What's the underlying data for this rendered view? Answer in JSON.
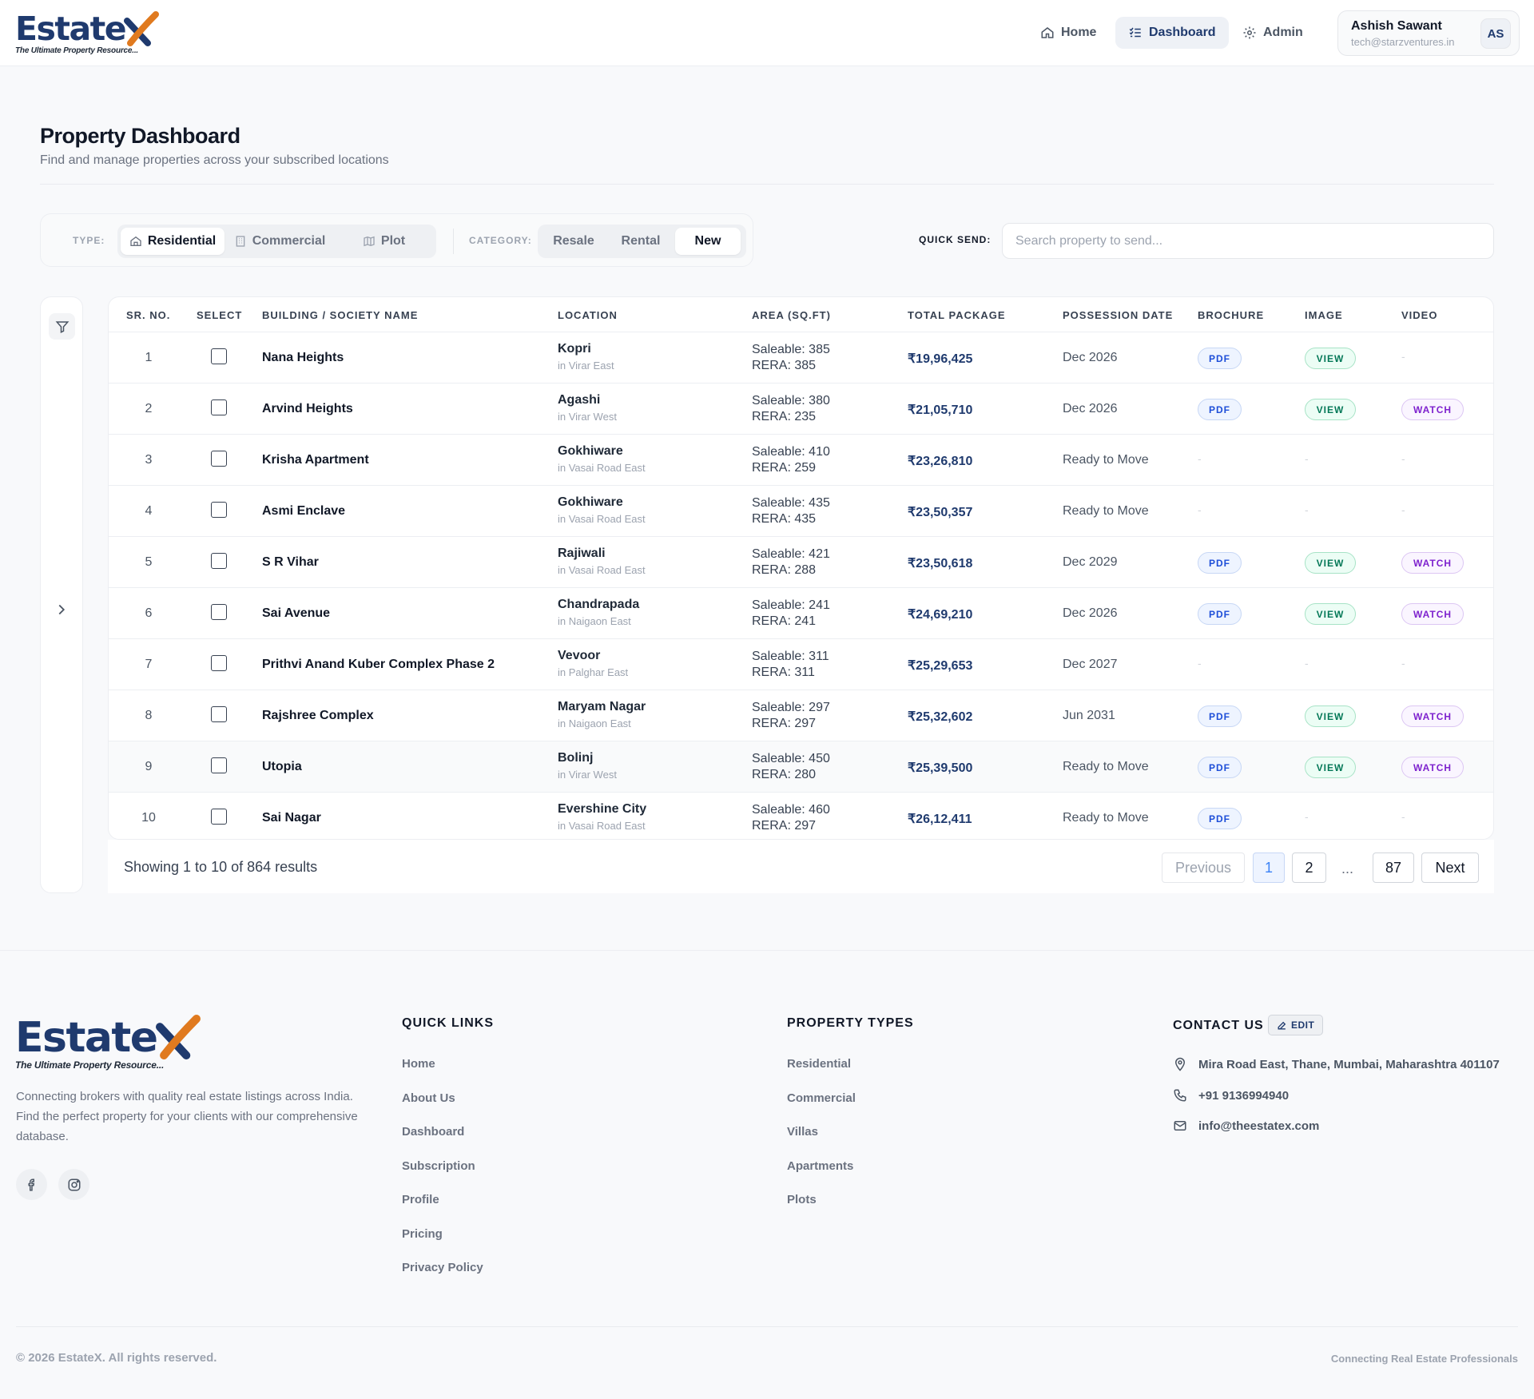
{
  "brand": {
    "name": "Estate",
    "tagline": "The Ultimate Property Resource..."
  },
  "nav": {
    "home": "Home",
    "dashboard": "Dashboard",
    "admin": "Admin"
  },
  "user": {
    "name": "Ashish Sawant",
    "email": "tech@starzventures.in",
    "initials": "AS"
  },
  "page": {
    "title": "Property Dashboard",
    "subtitle": "Find and manage properties across your subscribed locations"
  },
  "filters": {
    "type_label": "TYPE:",
    "types": [
      "Residential",
      "Commercial",
      "Plot"
    ],
    "active_type": "Residential",
    "category_label": "CATEGORY:",
    "categories": [
      "Resale",
      "Rental",
      "New"
    ],
    "active_category": "New"
  },
  "quick_send": {
    "label": "QUICK SEND:",
    "placeholder": "Search property to send..."
  },
  "table": {
    "headers": [
      "SR. NO.",
      "SELECT",
      "BUILDING / SOCIETY NAME",
      "LOCATION",
      "AREA (SQ.FT)",
      "TOTAL PACKAGE",
      "POSSESSION DATE",
      "BROCHURE",
      "IMAGE",
      "VIDEO"
    ],
    "labels": {
      "pdf": "PDF",
      "view": "VIEW",
      "watch": "WATCH",
      "none": "-"
    },
    "rows": [
      {
        "sr": "1",
        "name": "Nana Heights",
        "loc": "Kopri",
        "area_loc": "in Virar East",
        "saleable": "Saleable: 385",
        "rera": "RERA: 385",
        "price": "₹19,96,425",
        "possession": "Dec 2026",
        "pdf": true,
        "view": true,
        "watch": false
      },
      {
        "sr": "2",
        "name": "Arvind Heights",
        "loc": "Agashi",
        "area_loc": "in Virar West",
        "saleable": "Saleable: 380",
        "rera": "RERA: 235",
        "price": "₹21,05,710",
        "possession": "Dec 2026",
        "pdf": true,
        "view": true,
        "watch": true
      },
      {
        "sr": "3",
        "name": "Krisha Apartment",
        "loc": "Gokhiware",
        "area_loc": "in Vasai Road East",
        "saleable": "Saleable: 410",
        "rera": "RERA: 259",
        "price": "₹23,26,810",
        "possession": "Ready to Move",
        "pdf": false,
        "view": false,
        "watch": false
      },
      {
        "sr": "4",
        "name": "Asmi Enclave",
        "loc": "Gokhiware",
        "area_loc": "in Vasai Road East",
        "saleable": "Saleable: 435",
        "rera": "RERA: 435",
        "price": "₹23,50,357",
        "possession": "Ready to Move",
        "pdf": false,
        "view": false,
        "watch": false
      },
      {
        "sr": "5",
        "name": "S R Vihar",
        "loc": "Rajiwali",
        "area_loc": "in Vasai Road East",
        "saleable": "Saleable: 421",
        "rera": "RERA: 288",
        "price": "₹23,50,618",
        "possession": "Dec 2029",
        "pdf": true,
        "view": true,
        "watch": true
      },
      {
        "sr": "6",
        "name": "Sai Avenue",
        "loc": "Chandrapada",
        "area_loc": "in Naigaon East",
        "saleable": "Saleable: 241",
        "rera": "RERA: 241",
        "price": "₹24,69,210",
        "possession": "Dec 2026",
        "pdf": true,
        "view": true,
        "watch": true
      },
      {
        "sr": "7",
        "name": "Prithvi Anand Kuber Complex Phase 2",
        "loc": "Vevoor",
        "area_loc": "in Palghar East",
        "saleable": "Saleable: 311",
        "rera": "RERA: 311",
        "price": "₹25,29,653",
        "possession": "Dec 2027",
        "pdf": false,
        "view": false,
        "watch": false
      },
      {
        "sr": "8",
        "name": "Rajshree Complex",
        "loc": "Maryam Nagar",
        "area_loc": "in Naigaon East",
        "saleable": "Saleable: 297",
        "rera": "RERA: 297",
        "price": "₹25,32,602",
        "possession": "Jun 2031",
        "pdf": true,
        "view": true,
        "watch": true
      },
      {
        "sr": "9",
        "name": "Utopia",
        "loc": "Bolinj",
        "area_loc": "in Virar West",
        "saleable": "Saleable: 450",
        "rera": "RERA: 280",
        "price": "₹25,39,500",
        "possession": "Ready to Move",
        "pdf": true,
        "view": true,
        "watch": true
      },
      {
        "sr": "10",
        "name": "Sai Nagar",
        "loc": "Evershine City",
        "area_loc": "in Vasai Road East",
        "saleable": "Saleable: 460",
        "rera": "RERA: 297",
        "price": "₹26,12,411",
        "possession": "Ready to Move",
        "pdf": true,
        "view": false,
        "watch": false
      }
    ]
  },
  "pagination": {
    "showing": "Showing 1 to 10 of 864 results",
    "previous": "Previous",
    "page1": "1",
    "page2": "2",
    "dots": "...",
    "last": "87",
    "next": "Next"
  },
  "footer": {
    "description": "Connecting brokers with quality real estate listings across India. Find the perfect property for your clients with our comprehensive database.",
    "quick_links_title": "QUICK LINKS",
    "quick_links": [
      "Home",
      "About Us",
      "Dashboard",
      "Subscription",
      "Profile",
      "Pricing",
      "Privacy Policy"
    ],
    "property_types_title": "PROPERTY TYPES",
    "property_types": [
      "Residential",
      "Commercial",
      "Villas",
      "Apartments",
      "Plots"
    ],
    "contact_title": "CONTACT US",
    "edit_label": "EDIT",
    "address": "Mira Road East, Thane, Mumbai, Maharashtra 401107",
    "phone": "+91 9136994940",
    "email": "info@theestatex.com",
    "copyright": "© 2026 EstateX. All rights reserved.",
    "tagline": "Connecting Real Estate Professionals"
  },
  "colors": {
    "brand_navy": "#1f3a6e",
    "brand_orange": "#e07a1f"
  },
  "icons": [
    "home-icon",
    "dashboard-icon",
    "gear-icon",
    "building-icon",
    "office-icon",
    "map-icon",
    "filter-icon",
    "chevron-right-icon",
    "facebook-icon",
    "instagram-icon",
    "edit-icon",
    "location-pin-icon",
    "phone-icon",
    "mail-icon"
  ]
}
